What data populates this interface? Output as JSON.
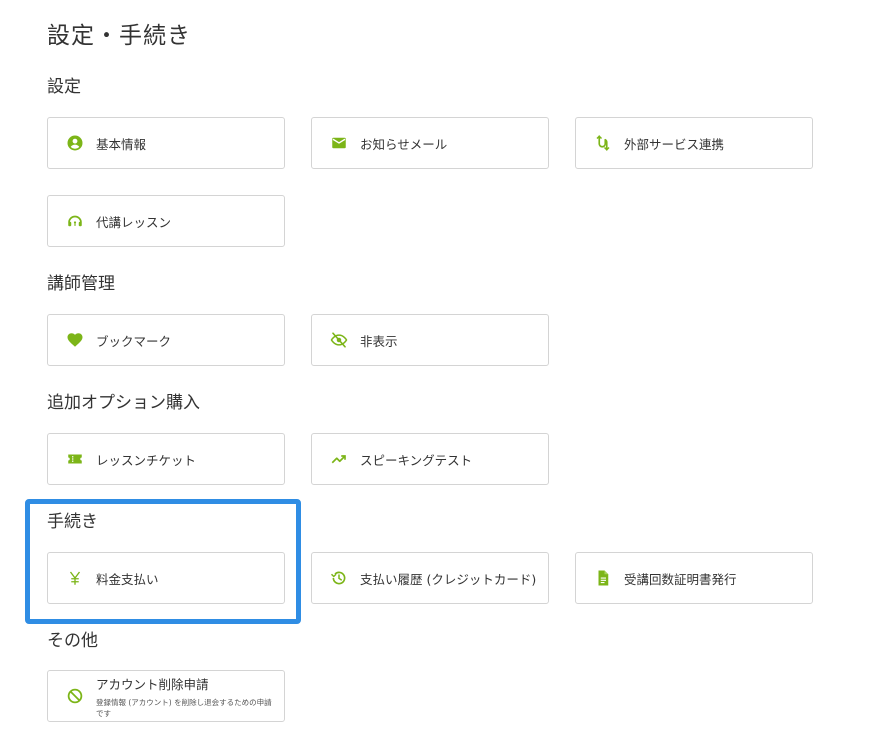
{
  "page": {
    "title": "設定・手続き"
  },
  "colors": {
    "accent": "#7cb518",
    "highlight": "#2f8de4",
    "border": "#d4d4d4"
  },
  "sections": {
    "settings": {
      "title": "設定",
      "items": [
        {
          "label": "基本情報",
          "icon": "account-circle-icon"
        },
        {
          "label": "お知らせメール",
          "icon": "mail-icon"
        },
        {
          "label": "外部サービス連携",
          "icon": "connection-icon"
        },
        {
          "label": "代講レッスン",
          "icon": "headset-icon"
        }
      ]
    },
    "tutor": {
      "title": "講師管理",
      "items": [
        {
          "label": "ブックマーク",
          "icon": "heart-icon"
        },
        {
          "label": "非表示",
          "icon": "eye-off-icon"
        }
      ]
    },
    "options": {
      "title": "追加オプション購入",
      "items": [
        {
          "label": "レッスンチケット",
          "icon": "ticket-icon"
        },
        {
          "label": "スピーキングテスト",
          "icon": "trending-up-icon"
        }
      ]
    },
    "procedures": {
      "title": "手続き",
      "items": [
        {
          "label": "料金支払い",
          "icon": "yen-icon"
        },
        {
          "label": "支払い履歴 (クレジットカード)",
          "icon": "history-icon"
        },
        {
          "label": "受講回数証明書発行",
          "icon": "document-icon"
        }
      ]
    },
    "other": {
      "title": "その他",
      "items": [
        {
          "label": "アカウント削除申請",
          "sub": "登録情報 (アカウント) を削除し退会するための申請です",
          "icon": "block-icon"
        }
      ]
    }
  }
}
